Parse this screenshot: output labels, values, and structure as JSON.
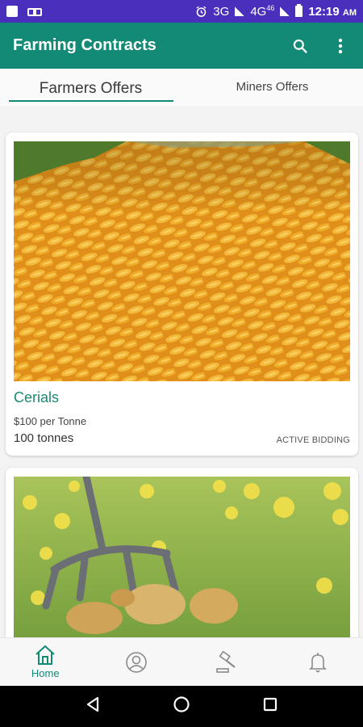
{
  "status_bar": {
    "network": "3G",
    "network2": "4G",
    "network2_sup": "46",
    "time": "12:19",
    "ampm": "AM"
  },
  "app": {
    "title": "Farming Contracts",
    "accent": "#138a75",
    "status_color": "#4a2fbd"
  },
  "tabs": [
    {
      "label": "Farmers Offers",
      "active": true
    },
    {
      "label": "Miners Offers",
      "active": false
    }
  ],
  "offers": [
    {
      "title": "Cerials",
      "price": "$100 per  Tonne",
      "quantity": "100 tonnes",
      "status": "ACTIVE BIDDING",
      "image": "corn-pile"
    },
    {
      "image": "potatoes-pitchfork"
    }
  ],
  "bottom_nav": [
    {
      "icon": "home-icon",
      "label": "Home",
      "active": true
    },
    {
      "icon": "profile-icon",
      "label": ""
    },
    {
      "icon": "gavel-icon",
      "label": ""
    },
    {
      "icon": "bell-icon",
      "label": ""
    }
  ]
}
